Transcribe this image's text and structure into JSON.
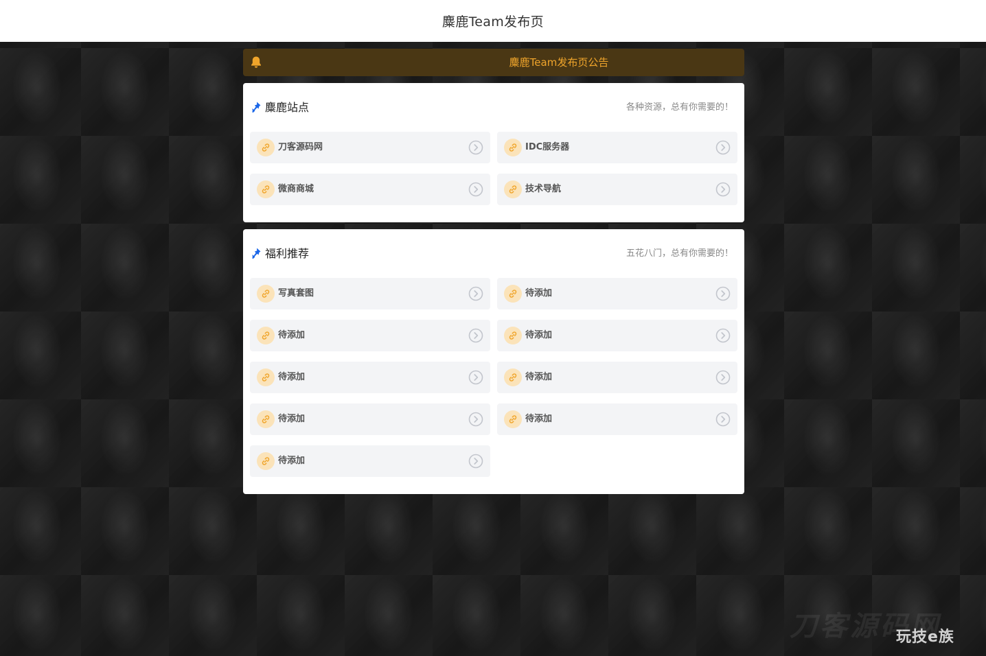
{
  "header": {
    "title": "麋鹿Team发布页"
  },
  "notice": {
    "text": "麋鹿Team发布页公告",
    "icon": "bell-icon"
  },
  "colors": {
    "accent": "#f0a52b",
    "notice_bg": "#4a3714",
    "pin_blue": "#1a66e8",
    "card_bg": "#ffffff",
    "item_bg": "#f3f4f6"
  },
  "sections": [
    {
      "title": "麋鹿站点",
      "subtitle": "各种资源，总有你需要的！",
      "items": [
        {
          "label": "刀客源码网"
        },
        {
          "label": "IDC服务器"
        },
        {
          "label": "微商商城"
        },
        {
          "label": "技术导航"
        }
      ]
    },
    {
      "title": "福利推荐",
      "subtitle": "五花八门，总有你需要的！",
      "items": [
        {
          "label": "写真套图"
        },
        {
          "label": "待添加"
        },
        {
          "label": "待添加"
        },
        {
          "label": "待添加"
        },
        {
          "label": "待添加"
        },
        {
          "label": "待添加"
        },
        {
          "label": "待添加"
        },
        {
          "label": "待添加"
        },
        {
          "label": "待添加"
        }
      ]
    }
  ],
  "watermark": {
    "text": "玩技e族",
    "faint_text": "刀客源码网"
  }
}
